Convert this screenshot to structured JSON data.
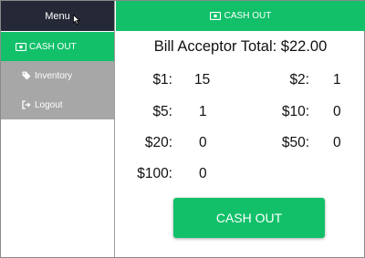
{
  "sidebar": {
    "menu_label": "Menu",
    "items": [
      {
        "label": "CASH OUT",
        "icon": "cash-icon"
      },
      {
        "label": "Inventory",
        "icon": "tag-icon"
      },
      {
        "label": "Logout",
        "icon": "logout-icon"
      }
    ]
  },
  "header": {
    "label": "CASH OUT",
    "icon": "cash-icon"
  },
  "main": {
    "title": "Bill Acceptor Total: $22.00",
    "bills": [
      {
        "label": "$1:",
        "count": "15"
      },
      {
        "label": "$2:",
        "count": "1"
      },
      {
        "label": "$5:",
        "count": "1"
      },
      {
        "label": "$10:",
        "count": "0"
      },
      {
        "label": "$20:",
        "count": "0"
      },
      {
        "label": "$50:",
        "count": "0"
      },
      {
        "label": "$100:",
        "count": "0"
      }
    ],
    "cash_out_button": "CASH OUT"
  },
  "colors": {
    "accent": "#12c06a",
    "menu_bg": "#252836",
    "submenu_bg": "#a7a7a7"
  }
}
